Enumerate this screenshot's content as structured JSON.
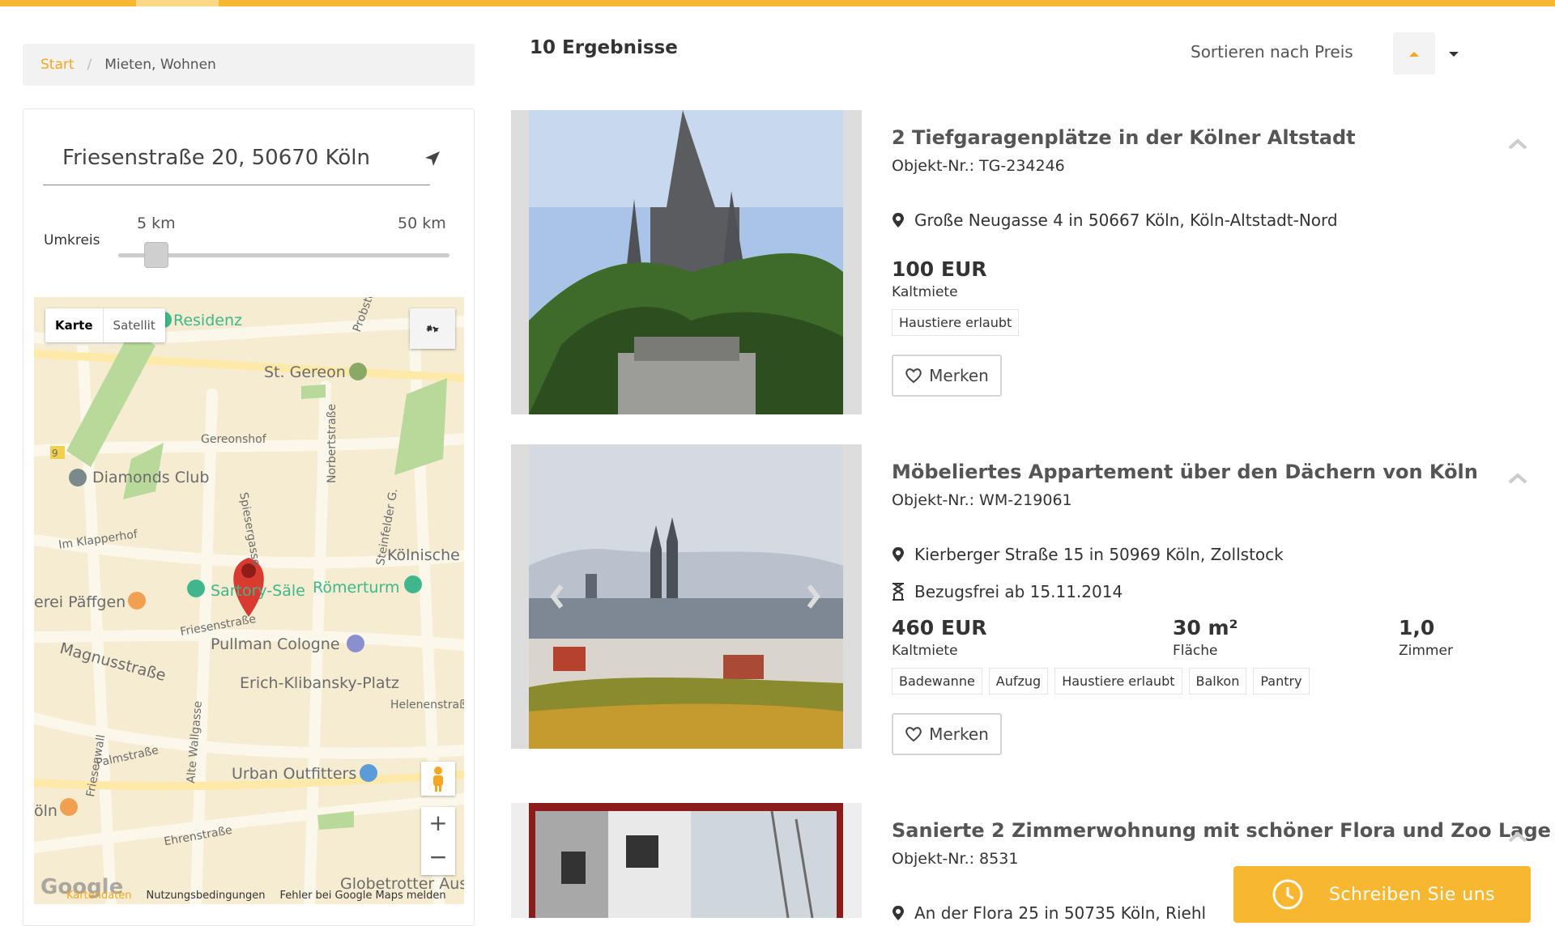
{
  "breadcrumb": {
    "home": "Start",
    "separator": "/",
    "current": "Mieten, Wohnen"
  },
  "search": {
    "address": "Friesenstraße 20, 50670 Köln",
    "radius_label": "Umkreis",
    "min_label": "5 km",
    "max_label": "50 km",
    "radius_value_km": 5
  },
  "map": {
    "type_map": "Karte",
    "type_satellite": "Satellit",
    "footer_data": "Kartendaten",
    "footer_terms": "Nutzungsbedingungen",
    "footer_report": "Fehler bei Google Maps melden",
    "google_logo": "Google",
    "labels": {
      "residenz": "Residenz",
      "st_gereon": "St. Gereon",
      "gereonshof": "Gereonshof",
      "diamonds": "Diamonds Club",
      "klapperhof": "Im Klapperhof",
      "spiesergasse": "Spiesergasse",
      "norbertstrasse": "Norbertstraße",
      "steinfelder": "Steinfelder G.",
      "koelnische": "Kölnische",
      "paeffgen": "erei Päffgen",
      "sartory": "Sartory-Säle",
      "roemerturm": "Römerturm",
      "friesenstrasse": "Friesenstraße",
      "pullman": "Pullman Cologne",
      "magnusstrasse": "Magnusstraße",
      "klibansky": "Erich-Klibansky-Platz",
      "helenenstr": "Helenenstraß",
      "friesenwall": "Friesenwall",
      "alte_wallgasse": "Alte Wallgasse",
      "palmstrasse": "Palmstraße",
      "urban": "Urban Outfitters",
      "oln": "öln",
      "ehrenstrasse": "Ehrenstraße",
      "globetrotter": "Globetrotter Aus",
      "probsteig": "Probsteig",
      "nine": "9"
    }
  },
  "results": {
    "count_label": "10 Ergebnisse",
    "sort_label": "Sortieren nach Preis"
  },
  "listings": [
    {
      "title": "2 Tiefgaragenplätze in der Kölner Altstadt",
      "object_no": "Objekt-Nr.: TG-234246",
      "address": "Große Neugasse 4 in 50667 Köln, Köln-Altstadt-Nord",
      "price": "100 EUR",
      "price_label": "Kaltmiete",
      "tags": [
        "Haustiere erlaubt"
      ],
      "merken": "Merken"
    },
    {
      "title": "Möbeliertes Appartement über den Dächern von Köln",
      "object_no": "Objekt-Nr.: WM-219061",
      "address": "Kierberger Straße 15 in 50969 Köln, Zollstock",
      "availability": "Bezugsfrei ab 15.11.2014",
      "price": "460 EUR",
      "price_label": "Kaltmiete",
      "area": "30 m²",
      "area_label": "Fläche",
      "rooms": "1,0",
      "rooms_label": "Zimmer",
      "tags": [
        "Badewanne",
        "Aufzug",
        "Haustiere erlaubt",
        "Balkon",
        "Pantry"
      ],
      "merken": "Merken"
    },
    {
      "title": "Sanierte 2 Zimmerwohnung mit schöner Flora und Zoo Lage",
      "object_no": "Objekt-Nr.: 8531",
      "address": "An der Flora 25 in 50735 Köln, Riehl"
    }
  ],
  "chat": {
    "label": "Schreiben Sie uns"
  },
  "colors": {
    "accent": "#f7b731",
    "link": "#f5a623",
    "map_bg": "#f5ecd2",
    "marker": "#d93b30"
  },
  "icons": [
    "location-arrow-icon",
    "map-pin-icon",
    "hourglass-icon",
    "heart-icon",
    "chevron-up-icon",
    "caret-down-icon",
    "sort-up-icon",
    "chat-bubble-icon"
  ]
}
